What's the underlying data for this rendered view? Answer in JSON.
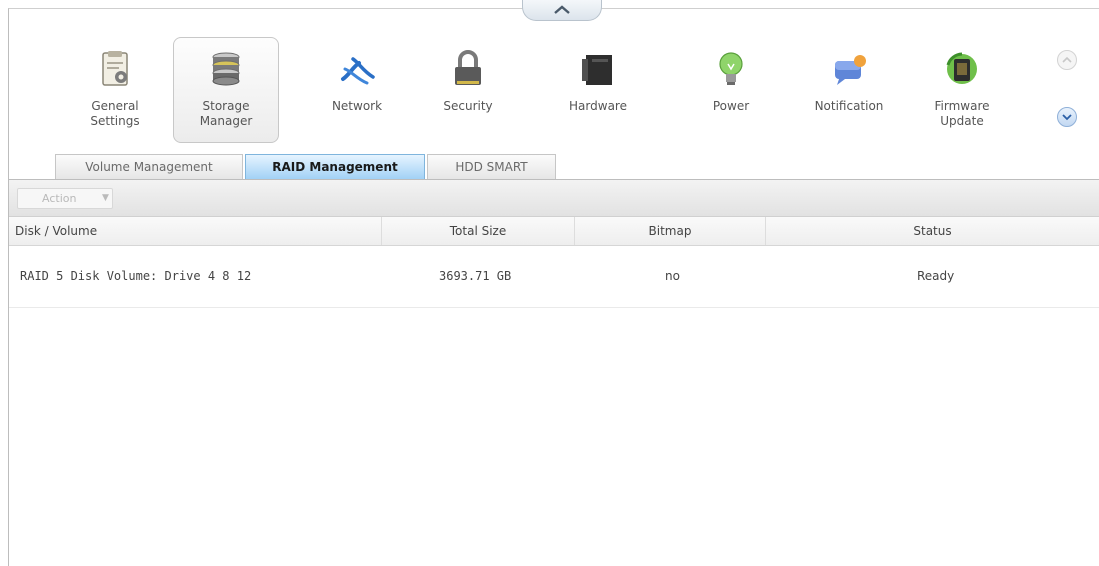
{
  "toolbar": {
    "items": [
      {
        "label": "General\nSettings",
        "icon": "settings-doc-icon"
      },
      {
        "label": "Storage\nManager",
        "icon": "hard-disk-icon",
        "active": true
      },
      {
        "label": "Network",
        "icon": "network-icon"
      },
      {
        "label": "Security",
        "icon": "padlock-icon"
      },
      {
        "label": "Hardware",
        "icon": "hardware-icon"
      },
      {
        "label": "Power",
        "icon": "light-bulb-icon"
      },
      {
        "label": "Notification",
        "icon": "notification-icon"
      },
      {
        "label": "Firmware\nUpdate",
        "icon": "firmware-update-icon"
      }
    ]
  },
  "tabs": [
    {
      "label": "Volume Management",
      "active": false
    },
    {
      "label": "RAID Management",
      "active": true
    },
    {
      "label": "HDD SMART",
      "active": false
    }
  ],
  "action": {
    "label": "Action"
  },
  "table": {
    "columns": [
      "Disk / Volume",
      "Total Size",
      "Bitmap",
      "Status"
    ],
    "rows": [
      {
        "volume": "RAID 5 Disk Volume: Drive 4 8 12",
        "size": "3693.71 GB",
        "bitmap": "no",
        "status": "Ready"
      }
    ]
  },
  "colors": {
    "active_tab": "#9fd0f5",
    "accent": "#7fb5dd"
  }
}
